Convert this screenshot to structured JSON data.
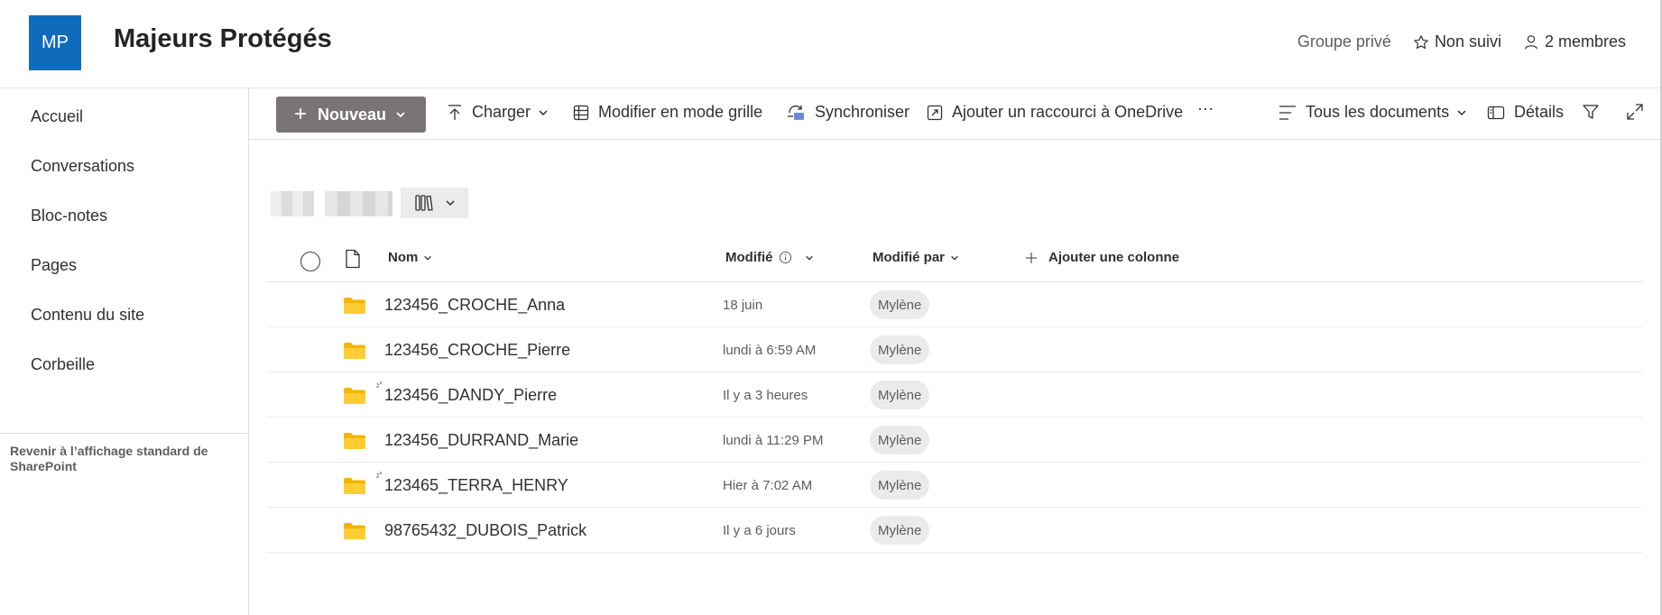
{
  "site": {
    "logo_initials": "MP",
    "title": "Majeurs Protégés",
    "privacy": "Groupe privé",
    "follow_label": "Non suivi",
    "members_label": "2 membres",
    "accent_color": "#0f6cbd"
  },
  "nav": {
    "items": [
      {
        "label": "Accueil"
      },
      {
        "label": "Conversations"
      },
      {
        "label": "Bloc-notes"
      },
      {
        "label": "Pages"
      },
      {
        "label": "Contenu du site"
      },
      {
        "label": "Corbeille"
      }
    ],
    "return_label": "Revenir à l’affichage standard de SharePoint"
  },
  "commandbar": {
    "new_label": "Nouveau",
    "upload_label": "Charger",
    "grid_label": "Modifier en mode grille",
    "sync_label": "Synchroniser",
    "shortcut_label": "Ajouter un raccourci à OneDrive",
    "more_label": "···",
    "view_label": "Tous les documents",
    "details_label": "Détails"
  },
  "table": {
    "columns": {
      "name": "Nom",
      "modified": "Modifié",
      "modified_by": "Modifié par",
      "add_column": "Ajouter une colonne"
    },
    "rows": [
      {
        "name": "123456_CROCHE_Anna",
        "modified": "18 juin",
        "modified_by": "Mylène",
        "syncing": false
      },
      {
        "name": "123456_CROCHE_Pierre",
        "modified": "lundi à 6:59 AM",
        "modified_by": "Mylène",
        "syncing": false
      },
      {
        "name": "123456_DANDY_Pierre",
        "modified": "Il y a 3 heures",
        "modified_by": "Mylène",
        "syncing": true
      },
      {
        "name": "123456_DURRAND_Marie",
        "modified": "lundi à 11:29 PM",
        "modified_by": "Mylène",
        "syncing": false
      },
      {
        "name": "123465_TERRA_HENRY",
        "modified": "Hier à 7:02 AM",
        "modified_by": "Mylène",
        "syncing": true
      },
      {
        "name": "98765432_DUBOIS_Patrick",
        "modified": "Il y a 6 jours",
        "modified_by": "Mylène",
        "syncing": false
      }
    ]
  }
}
